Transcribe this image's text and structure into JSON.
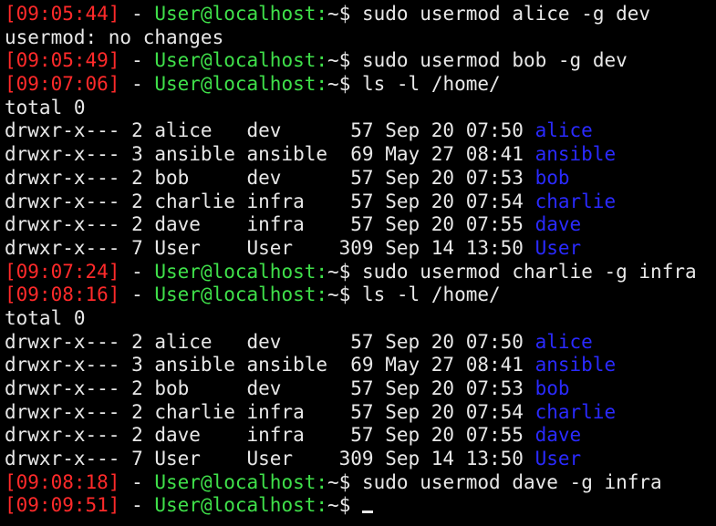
{
  "terminal": {
    "colors": {
      "background": "#000000",
      "text": "#e8e8e8",
      "timestamp": "#ff2a2a",
      "user": "#3fe04a",
      "directory": "#2a2aff"
    },
    "prompt_suffix": "$ ",
    "lines": [
      {
        "type": "prompt",
        "ts": "[09:05:44]",
        "sep": " - ",
        "user": "User@localhost:",
        "path": "~",
        "cmd": "$ sudo usermod alice -g dev"
      },
      {
        "type": "text",
        "text": "usermod: no changes"
      },
      {
        "type": "prompt",
        "ts": "[09:05:49]",
        "sep": " - ",
        "user": "User@localhost:",
        "path": "~",
        "cmd": "$ sudo usermod bob -g dev"
      },
      {
        "type": "prompt",
        "ts": "[09:07:06]",
        "sep": " - ",
        "user": "User@localhost:",
        "path": "~",
        "cmd": "$ ls -l /home/"
      },
      {
        "type": "text",
        "text": "total 0"
      },
      {
        "type": "entry",
        "meta": "drwxr-x--- 2 alice   dev      57 Sep 20 07:50 ",
        "name": "alice"
      },
      {
        "type": "entry",
        "meta": "drwxr-x--- 3 ansible ansible  69 May 27 08:41 ",
        "name": "ansible"
      },
      {
        "type": "entry",
        "meta": "drwxr-x--- 2 bob     dev      57 Sep 20 07:53 ",
        "name": "bob"
      },
      {
        "type": "entry",
        "meta": "drwxr-x--- 2 charlie infra    57 Sep 20 07:54 ",
        "name": "charlie"
      },
      {
        "type": "entry",
        "meta": "drwxr-x--- 2 dave    infra    57 Sep 20 07:55 ",
        "name": "dave"
      },
      {
        "type": "entry",
        "meta": "drwxr-x--- 7 User    User    309 Sep 14 13:50 ",
        "name": "User"
      },
      {
        "type": "prompt",
        "ts": "[09:07:24]",
        "sep": " - ",
        "user": "User@localhost:",
        "path": "~",
        "cmd": "$ sudo usermod charlie -g infra"
      },
      {
        "type": "prompt",
        "ts": "[09:08:16]",
        "sep": " - ",
        "user": "User@localhost:",
        "path": "~",
        "cmd": "$ ls -l /home/"
      },
      {
        "type": "text",
        "text": "total 0"
      },
      {
        "type": "entry",
        "meta": "drwxr-x--- 2 alice   dev      57 Sep 20 07:50 ",
        "name": "alice"
      },
      {
        "type": "entry",
        "meta": "drwxr-x--- 3 ansible ansible  69 May 27 08:41 ",
        "name": "ansible"
      },
      {
        "type": "entry",
        "meta": "drwxr-x--- 2 bob     dev      57 Sep 20 07:53 ",
        "name": "bob"
      },
      {
        "type": "entry",
        "meta": "drwxr-x--- 2 charlie infra    57 Sep 20 07:54 ",
        "name": "charlie"
      },
      {
        "type": "entry",
        "meta": "drwxr-x--- 2 dave    infra    57 Sep 20 07:55 ",
        "name": "dave"
      },
      {
        "type": "entry",
        "meta": "drwxr-x--- 7 User    User    309 Sep 14 13:50 ",
        "name": "User"
      },
      {
        "type": "prompt",
        "ts": "[09:08:18]",
        "sep": " - ",
        "user": "User@localhost:",
        "path": "~",
        "cmd": "$ sudo usermod dave -g infra"
      },
      {
        "type": "prompt",
        "ts": "[09:09:51]",
        "sep": " - ",
        "user": "User@localhost:",
        "path": "~",
        "cmd": "$ ",
        "cursor": true
      }
    ]
  }
}
